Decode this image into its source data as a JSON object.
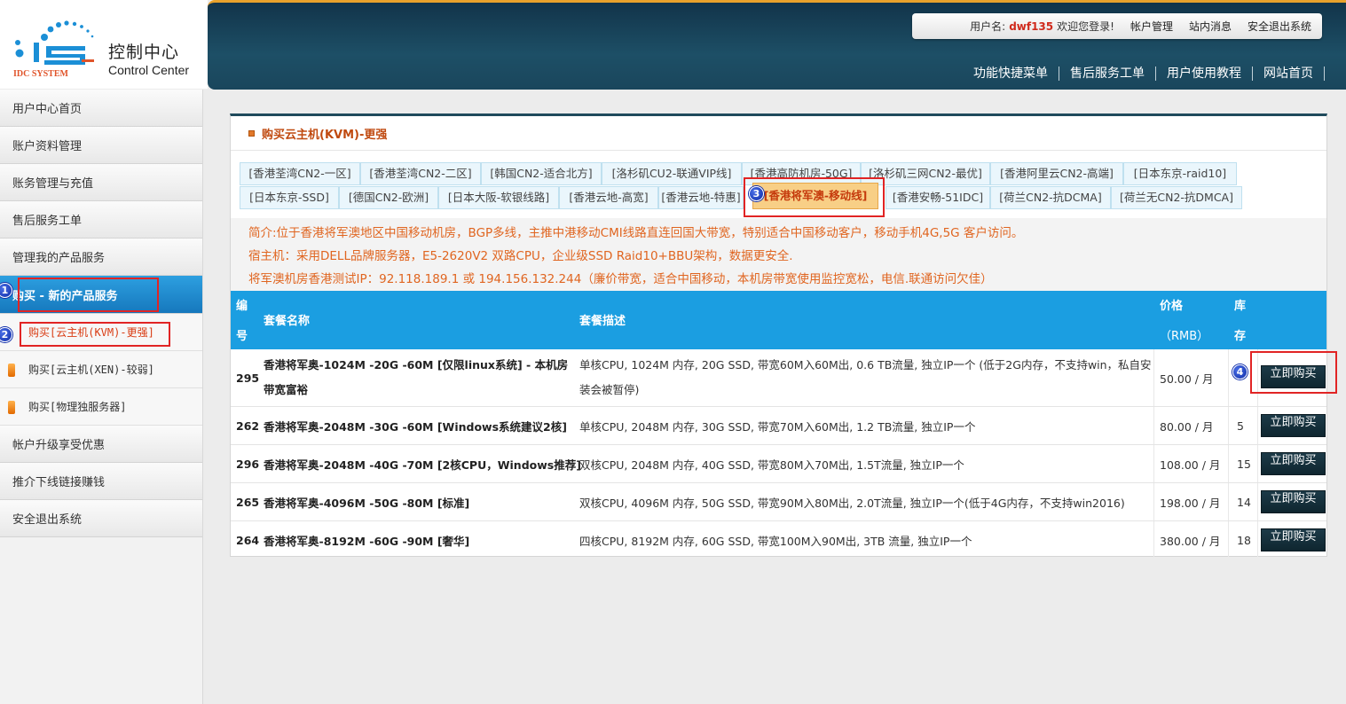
{
  "brand": {
    "title": "控制中心",
    "subtitle": "Control Center",
    "logo_text": "IDC SYSTEM",
    "colors": {
      "topbar": "#1d4f66",
      "accent": "#1b9ee1",
      "orange": "#e06520"
    }
  },
  "user_bar": {
    "username_label": "用户名:",
    "username": "dwf135",
    "welcome": "欢迎您登录!",
    "links": [
      "帐户管理",
      "站内消息",
      "安全退出系统"
    ]
  },
  "nav": [
    "功能快捷菜单",
    "售后服务工单",
    "用户使用教程",
    "网站首页"
  ],
  "sidebar": {
    "items_top": [
      "用户中心首页",
      "账户资料管理",
      "账务管理与充值",
      "售后服务工单",
      "管理我的产品服务"
    ],
    "active_label": "购买 - 新的产品服务",
    "sub_items": [
      "购买[云主机(KVM)-更强]",
      "购买[云主机(XEN)-较弱]",
      "购买[物理独服务器]"
    ],
    "items_bottom": [
      "帐户升级享受优惠",
      "推介下线链接赚钱",
      "安全退出系统"
    ]
  },
  "panel": {
    "title": "购买云主机(KVM)-更强",
    "tabs_row1": [
      "[香港荃湾CN2-一区]",
      "[香港荃湾CN2-二区]",
      "[韩国CN2-适合北方]",
      "[洛杉矶CU2-联通VIP线]",
      "[香港高防机房-50G]",
      "[洛杉矶三网CN2-最优]",
      "[香港阿里云CN2-高端]",
      "[日本东京-raid10]"
    ],
    "tabs_row2": [
      "[日本东京-SSD]",
      "[德国CN2-欧洲]",
      "[日本大阪-软银线路]",
      "[香港云地-高宽]",
      "[香港云地-特惠]",
      "[香港将军澳-移动线]",
      "[香港安畅-51IDC]",
      "[荷兰CN2-抗DCMA]",
      "[荷兰无CN2-抗DMCA]"
    ],
    "intro": [
      "简介:位于香港将军澳地区中国移动机房，BGP多线，主推中港移动CMI线路直连回国大带宽，特别适合中国移动客户，移动手机4G,5G 客户访问。",
      "宿主机：采用DELL品牌服务器，E5-2620V2 双路CPU，企业级SSD Raid10+BBU架构，数据更安全.",
      "将军澳机房香港测试IP：92.118.189.1 或 194.156.132.244（廉价带宽，适合中国移动，本机房带宽使用监控宽松，电信.联通访问欠佳）"
    ]
  },
  "table": {
    "headers": {
      "id_1": "编",
      "id_2": "号",
      "name": "套餐名称",
      "desc": "套餐描述",
      "price_1": "价格",
      "price_2": "（RMB）",
      "stock_1": "库",
      "stock_2": "存"
    },
    "buy_label": "立即购买",
    "rows": [
      {
        "id": "295",
        "name": "香港将军奥-1024M -20G -60M [仅限linux系统] - 本机房带宽富裕",
        "desc": "单核CPU, 1024M 内存, 20G SSD, 带宽60M入60M出, 0.6 TB流量, 独立IP一个 (低于2G内存，不支持win，私自安装会被暂停)",
        "price": "50.00 / 月",
        "stock": ""
      },
      {
        "id": "262",
        "name": "香港将军奥-2048M -30G -60M [Windows系统建议2核]",
        "desc": "单核CPU, 2048M 内存, 30G SSD, 带宽70M入60M出, 1.2 TB流量, 独立IP一个",
        "price": "80.00 / 月",
        "stock": "5"
      },
      {
        "id": "296",
        "name": "香港将军奥-2048M -40G -70M [2核CPU，Windows推荐]",
        "desc": "双核CPU, 2048M 内存, 40G SSD, 带宽80M入70M出, 1.5T流量, 独立IP一个",
        "price": "108.00 / 月",
        "stock": "15"
      },
      {
        "id": "265",
        "name": "香港将军奥-4096M -50G -80M [标准]",
        "desc": "双核CPU, 4096M 内存, 50G SSD, 带宽90M入80M出, 2.0T流量, 独立IP一个(低于4G内存，不支持win2016)",
        "price": "198.00 / 月",
        "stock": "14"
      },
      {
        "id": "264",
        "name": "香港将军奥-8192M -60G -90M [奢华]",
        "desc": "四核CPU, 8192M 内存, 60G SSD, 带宽100M入90M出, 3TB 流量, 独立IP一个",
        "price": "380.00 / 月",
        "stock": "18"
      }
    ]
  },
  "annotations": [
    "1",
    "2",
    "3",
    "4"
  ]
}
